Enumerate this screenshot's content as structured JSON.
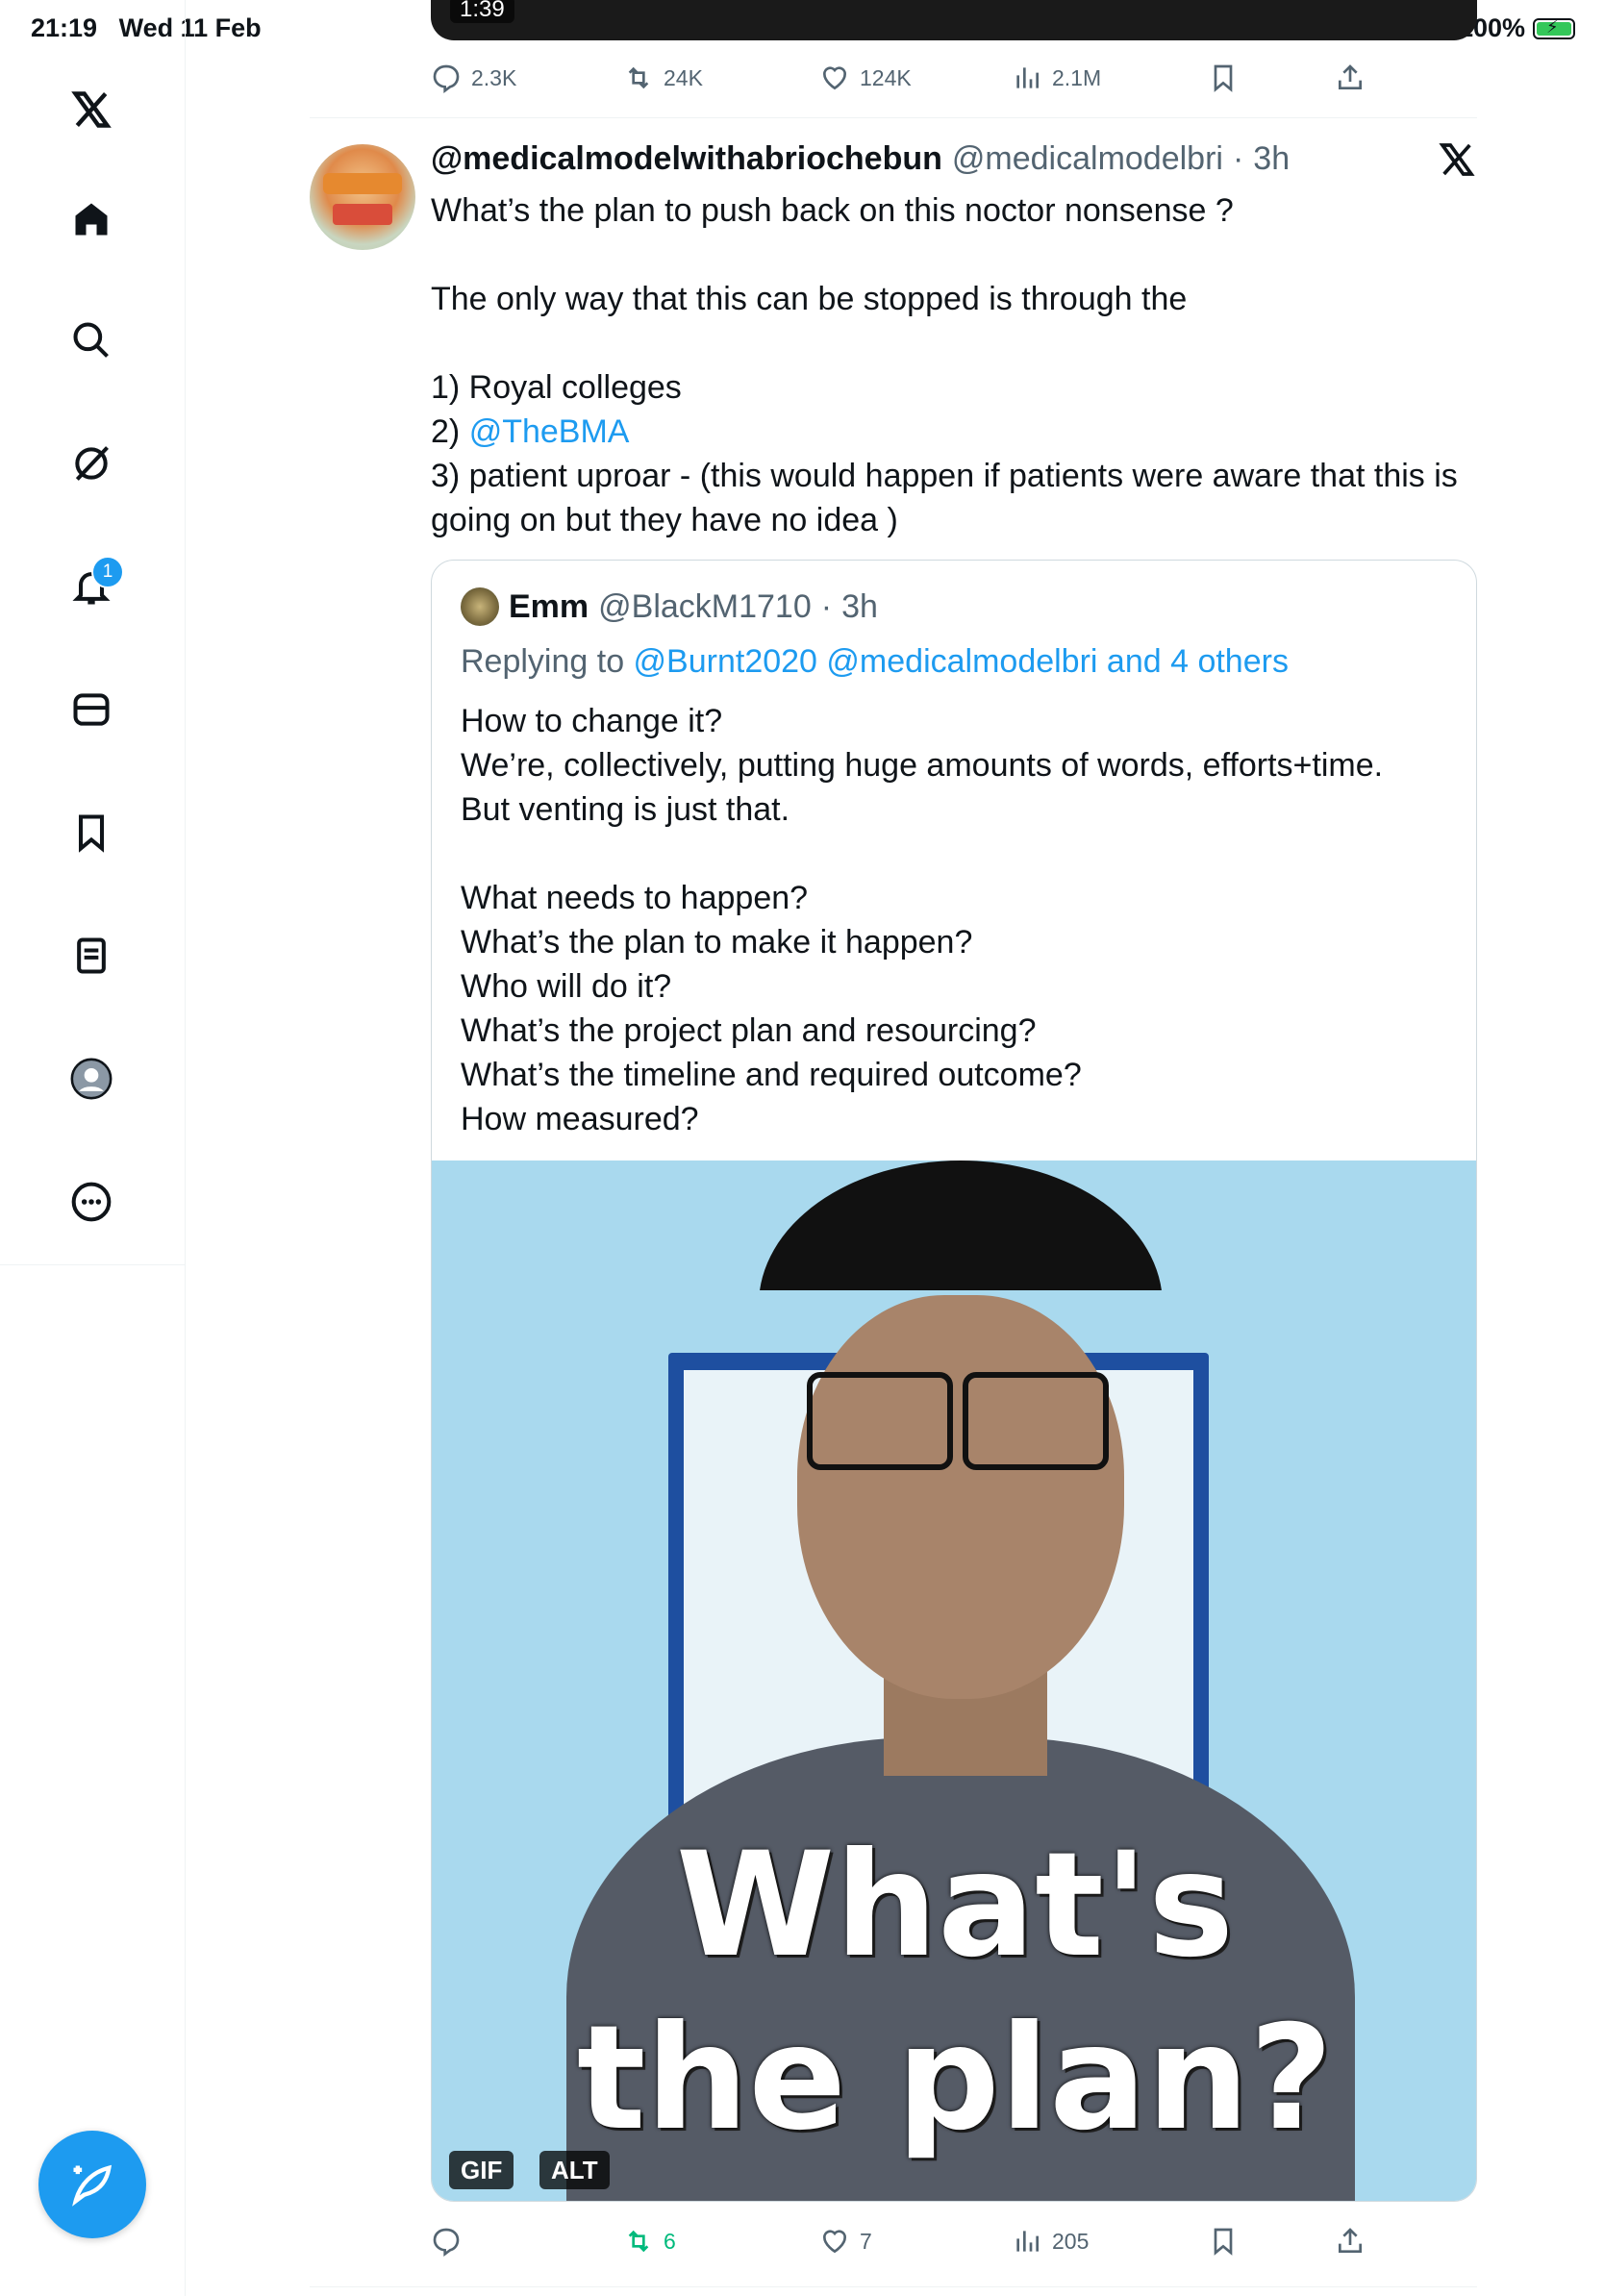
{
  "status_bar": {
    "time": "21:19",
    "date": "Wed 11 Feb",
    "battery": "100%"
  },
  "sidebar": {
    "items": [
      {
        "name": "x-logo",
        "icon": "x-logo-icon"
      },
      {
        "name": "home",
        "icon": "home-icon"
      },
      {
        "name": "search",
        "icon": "search-icon"
      },
      {
        "name": "grok",
        "icon": "grok-icon"
      },
      {
        "name": "notifications",
        "icon": "bell-icon",
        "badge": "1"
      },
      {
        "name": "messages",
        "icon": "mail-icon"
      },
      {
        "name": "bookmarks",
        "icon": "bookmark-icon"
      },
      {
        "name": "lists",
        "icon": "list-icon"
      },
      {
        "name": "profile",
        "icon": "profile-icon"
      },
      {
        "name": "more",
        "icon": "more-icon"
      }
    ],
    "compose_icon": "compose-icon"
  },
  "top_media": {
    "duration": "1:39"
  },
  "top_actions": {
    "replies": "2.3K",
    "reposts": "24K",
    "likes": "124K",
    "views": "2.1M"
  },
  "tweet": {
    "display_name": "@medicalmodelwithabriochebun",
    "handle": "@medicalmodelbri",
    "time": "3h",
    "line1": "What’s the plan to push back on this noctor nonsense ?",
    "line2": "The only way that this can be stopped is through the",
    "item1": "1) Royal colleges",
    "item2_prefix": "2) ",
    "item2_link": "@TheBMA",
    "item3": "3) patient uproar - (this would happen if patients were aware that this is going on but they have no idea )"
  },
  "quote": {
    "display_name": "Emm",
    "handle": "@BlackM1710",
    "time": "3h",
    "replying_prefix": "Replying to ",
    "replying_targets": "@Burnt2020 @medicalmodelbri and 4 others",
    "lines": [
      "How to change it?",
      "We’re, collectively, putting huge amounts of words, efforts+time.",
      "But venting is just that.",
      "",
      "What needs to happen?",
      "What’s the plan to make it happen?",
      "Who will do it?",
      "What’s the project plan and resourcing?",
      "What’s the timeline and required outcome?",
      "How measured?"
    ],
    "gif_caption_1": "What's",
    "gif_caption_2": "the plan?",
    "gif_tag": "GIF",
    "alt_tag": "ALT"
  },
  "bottom_actions": {
    "replies": "",
    "reposts": "6",
    "likes": "7",
    "views": "205"
  },
  "colors": {
    "accent": "#1d9bf0",
    "repost_active": "#00ba7c",
    "muted": "#536471",
    "text": "#0f1419"
  }
}
